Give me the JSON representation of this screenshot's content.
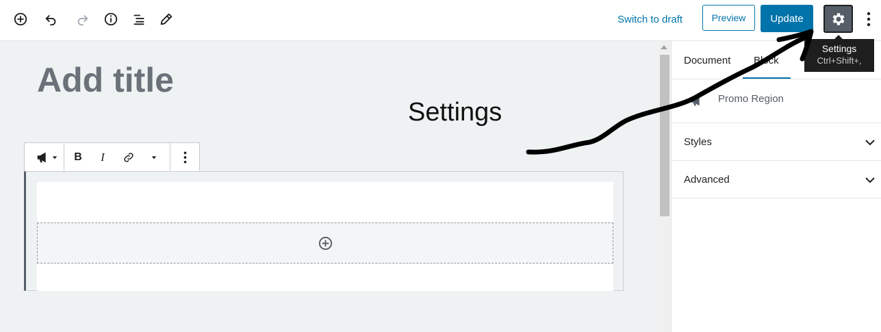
{
  "toolbar": {
    "switch_to_draft": "Switch to draft",
    "preview": "Preview",
    "update": "Update",
    "icons": [
      "add-block-icon",
      "undo-icon",
      "redo-icon",
      "info-icon",
      "outline-icon",
      "tools-pencil-icon"
    ]
  },
  "settings_tooltip": {
    "title": "Settings",
    "shortcut": "Ctrl+Shift+,"
  },
  "editor": {
    "title_placeholder": "Add title",
    "annotation": "Settings",
    "block_toolbar": {
      "block_icon": "megaphone-icon",
      "bold": "B",
      "italic": "I"
    }
  },
  "sidebar": {
    "tabs": [
      {
        "label": "Document"
      },
      {
        "label": "Block"
      }
    ],
    "active_tab": "Block",
    "block_name": "Promo Region",
    "panels": [
      {
        "label": "Styles"
      },
      {
        "label": "Advanced"
      }
    ]
  },
  "colors": {
    "accent": "#0073aa",
    "canvas": "#eef2f3",
    "settings_active": "#555d66"
  }
}
